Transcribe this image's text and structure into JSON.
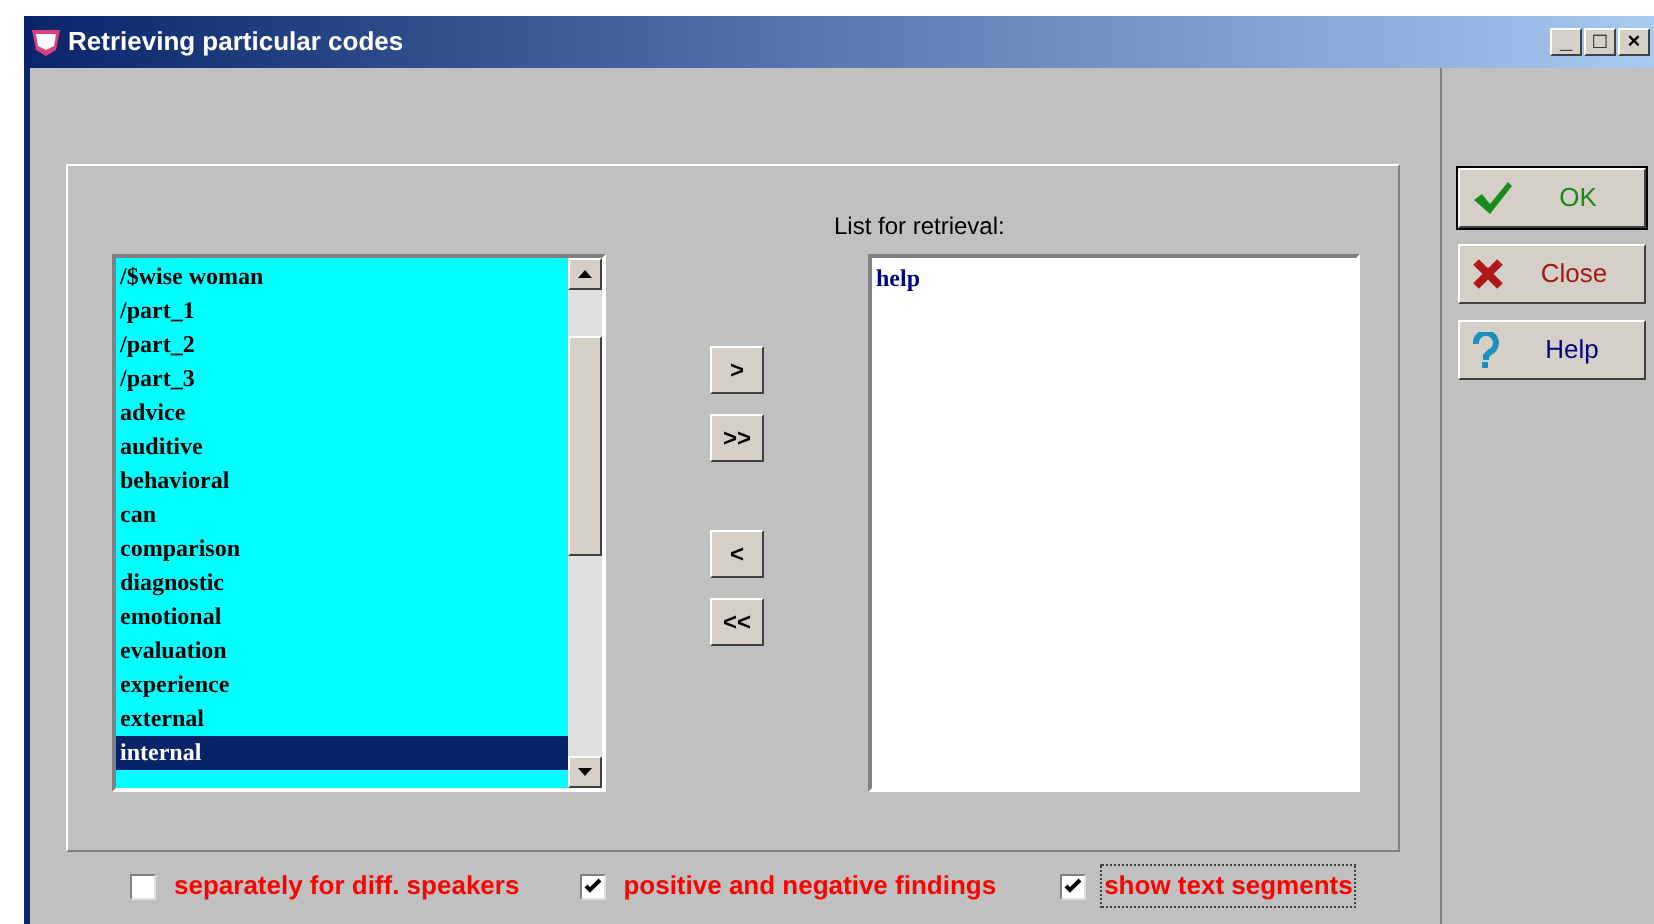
{
  "window": {
    "title": "Retrieving particular codes",
    "controls": [
      "_",
      "□",
      "×"
    ]
  },
  "codes": [
    {
      "label": "/$wise woman",
      "selected": false
    },
    {
      "label": "/part_1",
      "selected": false
    },
    {
      "label": "/part_2",
      "selected": false
    },
    {
      "label": "/part_3",
      "selected": false
    },
    {
      "label": "advice",
      "selected": false
    },
    {
      "label": "auditive",
      "selected": false
    },
    {
      "label": "behavioral",
      "selected": false
    },
    {
      "label": "can",
      "selected": false
    },
    {
      "label": "comparison",
      "selected": false
    },
    {
      "label": "diagnostic",
      "selected": false
    },
    {
      "label": "emotional",
      "selected": false
    },
    {
      "label": "evaluation",
      "selected": false
    },
    {
      "label": "experience",
      "selected": false
    },
    {
      "label": "external",
      "selected": false
    },
    {
      "label": "internal",
      "selected": true
    }
  ],
  "move_buttons": [
    ">",
    ">>",
    "<",
    "<<"
  ],
  "retrieval": {
    "label": "List for retrieval:",
    "items": [
      "help"
    ]
  },
  "buttons": [
    {
      "kind": "ok",
      "label": "OK"
    },
    {
      "kind": "close",
      "label": "Close"
    },
    {
      "kind": "help",
      "label": "Help"
    }
  ],
  "options": [
    {
      "label": "separately for diff. speakers",
      "checked": false,
      "focused": false
    },
    {
      "label": "positive and negative findings",
      "checked": true,
      "focused": false
    },
    {
      "label": "show text segments",
      "checked": true,
      "focused": true
    }
  ]
}
